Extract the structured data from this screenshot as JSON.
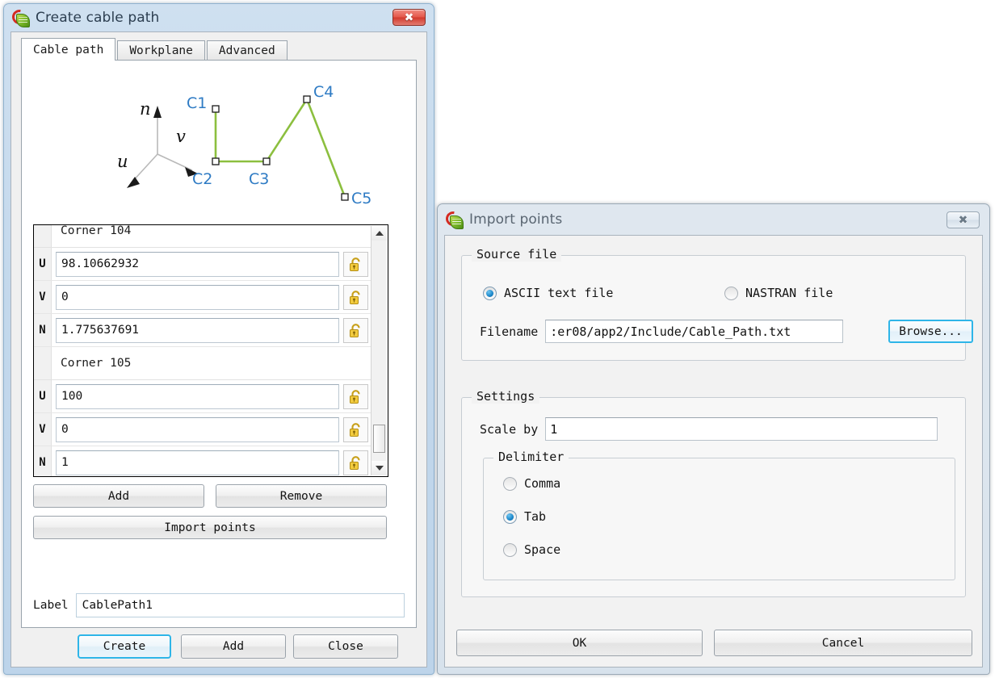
{
  "windows": {
    "create_cable_path": {
      "title": "Create cable path",
      "icon": "app-logo-icon",
      "close_glyph": "✖",
      "tabs": [
        {
          "label": "Cable path",
          "selected": true
        },
        {
          "label": "Workplane",
          "selected": false
        },
        {
          "label": "Advanced",
          "selected": false
        }
      ],
      "preview": {
        "axis_labels": {
          "n": "n",
          "v": "v",
          "u": "u"
        },
        "corner_labels": [
          "C1",
          "C2",
          "C3",
          "C4",
          "C5"
        ],
        "path_color": "#8cbf3f",
        "label_color": "#2e7bc4"
      },
      "corner_list": {
        "groups": [
          {
            "title": "Corner 104",
            "fields": [
              {
                "key": "U",
                "value": "98.10662932",
                "locked": false
              },
              {
                "key": "V",
                "value": "0",
                "locked": false
              },
              {
                "key": "N",
                "value": "1.775637691",
                "locked": false
              }
            ]
          },
          {
            "title": "Corner 105",
            "fields": [
              {
                "key": "U",
                "value": "100",
                "locked": false
              },
              {
                "key": "V",
                "value": "0",
                "locked": false
              },
              {
                "key": "N",
                "value": "1",
                "locked": false
              }
            ]
          }
        ],
        "lock_icon": "open-padlock-icon",
        "scroll_up_icon": "caret-up-icon",
        "scroll_down_icon": "caret-down-icon"
      },
      "buttons": {
        "add_row": "Add",
        "remove_row": "Remove",
        "import_points": "Import points",
        "create": "Create",
        "add": "Add",
        "close": "Close"
      },
      "label_field": {
        "caption": "Label",
        "value": "CablePath1"
      }
    },
    "import_points": {
      "title": "Import points",
      "icon": "app-logo-icon",
      "close_glyph": "✖",
      "source_file": {
        "group_title": "Source file",
        "options": [
          {
            "label": "ASCII text file",
            "selected": true
          },
          {
            "label": "NASTRAN file",
            "selected": false
          }
        ],
        "filename_caption": "Filename",
        "filename_value": ":er08/app2/Include/Cable_Path.txt",
        "browse_label": "Browse..."
      },
      "settings": {
        "group_title": "Settings",
        "scale_caption": "Scale by",
        "scale_value": "1",
        "delimiter": {
          "group_title": "Delimiter",
          "options": [
            {
              "label": "Comma",
              "selected": false
            },
            {
              "label": "Tab",
              "selected": true
            },
            {
              "label": "Space",
              "selected": false
            }
          ]
        }
      },
      "buttons": {
        "ok": "OK",
        "cancel": "Cancel"
      }
    }
  },
  "colors": {
    "accent_focus": "#2eb5e8",
    "title_active": "#c3d8ec",
    "title_inactive": "#dde6ee",
    "close_red": "#d23a2d",
    "path_green": "#8cbf3f",
    "corner_blue": "#2e7bc4"
  }
}
